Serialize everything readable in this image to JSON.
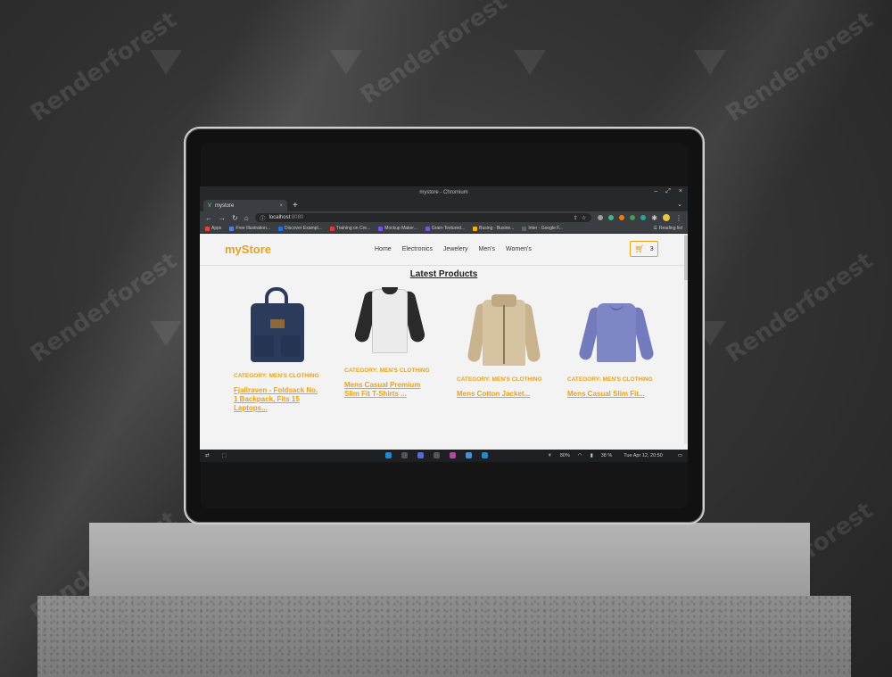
{
  "watermark": {
    "text": "Renderforest"
  },
  "window": {
    "title": "mystore - Chromium",
    "controls": [
      "–",
      "⤢",
      "×"
    ]
  },
  "tabs": [
    {
      "label": "mystore",
      "close": "×"
    }
  ],
  "newtab": "+",
  "address_bar": {
    "host": "localhost",
    "port": ":8080"
  },
  "bookmarks": [
    {
      "label": "Apps",
      "color": "#ea4335"
    },
    {
      "label": "Free Illustration...",
      "color": "#4285f4"
    },
    {
      "label": "Discover Exampl...",
      "color": "#1a73e8"
    },
    {
      "label": "Training on Cre...",
      "color": "#e53935"
    },
    {
      "label": "Mockup Maker...",
      "color": "#7c4dff"
    },
    {
      "label": "Grain-Textured...",
      "color": "#7c4dff"
    },
    {
      "label": "Busing - Busine...",
      "color": "#f4b400"
    },
    {
      "label": "Inter - Google F...",
      "color": "#5f6368"
    }
  ],
  "reading_list": "Reading list",
  "store": {
    "logo": "myStore",
    "nav": [
      "Home",
      "Electronics",
      "Jewelery",
      "Men's",
      "Women's"
    ],
    "cart_count": "3",
    "section_title": "Latest Products",
    "accent_color": "#e6a21d",
    "products": [
      {
        "category": "Category: MEN'S CLOTHING",
        "title": "Fjallraven - Foldsack No. 1 Backpack, Fits 15 Laptops...",
        "icon": "backpack"
      },
      {
        "category": "Category: MEN'S CLOTHING",
        "title": "Mens Casual Premium Slim Fit T-Shirts ...",
        "icon": "raglan-shirt"
      },
      {
        "category": "Category: MEN'S CLOTHING",
        "title": "Mens Cotton Jacket...",
        "icon": "jacket"
      },
      {
        "category": "Category: MEN'S CLOTHING",
        "title": "Mens Casual Slim Fit...",
        "icon": "long-sleeve-tee"
      }
    ]
  },
  "taskbar": {
    "battery": "38 %",
    "brightness": "80%",
    "datetime": "Tue Apr 12, 20:50"
  }
}
